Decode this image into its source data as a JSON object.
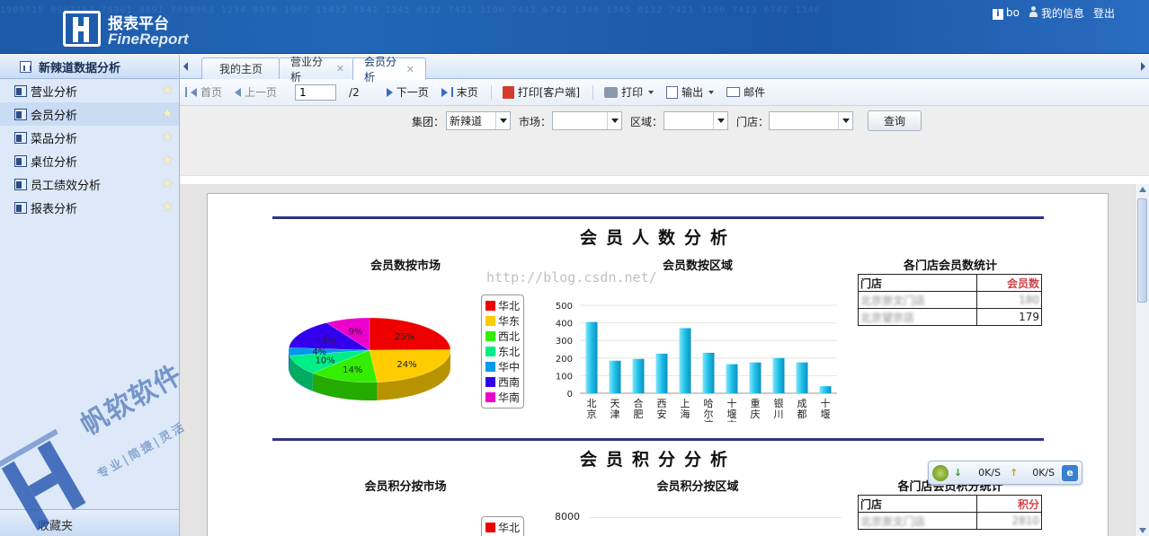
{
  "header": {
    "logo_title": "报表平台",
    "logo_sub": "FineReport",
    "username": "bo",
    "my_info": "我的信息",
    "logout": "登出",
    "bg_digits": "1989715 8987153 78961 9891 7698963 1234 8976 1987 15432 7842 1345 0132 7421 3190 7413 6742 1346 1345 0132 7421 3190 7413 6742 1346"
  },
  "sidebar": {
    "title": "新辣道数据分析",
    "items": [
      {
        "label": "营业分析"
      },
      {
        "label": "会员分析"
      },
      {
        "label": "菜品分析"
      },
      {
        "label": "桌位分析"
      },
      {
        "label": "员工绩效分析"
      },
      {
        "label": "报表分析"
      }
    ],
    "footer": "收藏夹"
  },
  "watermark": {
    "brand": "帆软软件",
    "slogan": "专业|简捷|灵活"
  },
  "tabs": [
    {
      "label": "我的主页"
    },
    {
      "label": "营业分析"
    },
    {
      "label": "会员分析"
    }
  ],
  "toolbar": {
    "first": "首页",
    "prev": "上一页",
    "page_value": "1",
    "page_total": "/2",
    "next": "下一页",
    "last": "末页",
    "print_client": "打印[客户端]",
    "print": "打印",
    "export": "输出",
    "mail": "邮件"
  },
  "params": {
    "group_label": "集团：",
    "group_value": "新辣道",
    "market_label": "市场：",
    "market_value": "",
    "region_label": "区域：",
    "region_value": "",
    "store_label": "门店：",
    "store_value": "",
    "query": "查询"
  },
  "report": {
    "sec1_title": "会员人数分析",
    "sec2_title": "会员积分分析",
    "watermark_url": "http://blog.csdn.net/",
    "table1": {
      "title": "各门店会员数统计",
      "col_store": "门店",
      "col_value": "会员数",
      "rows": [
        {
          "store": "北京崇文门店",
          "value": "180"
        },
        {
          "store": "北京望京店",
          "value": "179"
        }
      ]
    },
    "table2": {
      "title": "各门店会员积分统计",
      "col_store": "门店",
      "col_value": "积分",
      "rows": [
        {
          "store": "北京崇文门店",
          "value": "2810"
        }
      ]
    },
    "netmon": {
      "down": "0K/S",
      "up": "0K/S"
    }
  },
  "chart_data": [
    {
      "type": "pie",
      "title": "会员数按市场",
      "categories": [
        "华北",
        "华东",
        "西北",
        "东北",
        "华中",
        "西南",
        "华南"
      ],
      "values": [
        25,
        24,
        14,
        10,
        4,
        15,
        9
      ],
      "colors": [
        "#ee0000",
        "#ffcc00",
        "#33ee00",
        "#00ee88",
        "#0099ee",
        "#3300ee",
        "#ee00cc"
      ],
      "legend": "right"
    },
    {
      "type": "bar",
      "title": "会员数按区域",
      "categories": [
        "北京",
        "天津",
        "合肥",
        "西安",
        "上海",
        "哈尔滨",
        "十堰市",
        "重庆",
        "银川",
        "成都",
        "十堰"
      ],
      "values": [
        405,
        185,
        195,
        225,
        370,
        230,
        165,
        175,
        200,
        175,
        40
      ],
      "ylim": [
        0,
        500
      ],
      "yticks": [
        "500",
        "400",
        "300",
        "200",
        "100",
        "0"
      ],
      "color": "#1ec0e8"
    },
    {
      "type": "pie",
      "title": "会员积分按市场",
      "categories": [
        "华北"
      ],
      "colors": [
        "#ee0000"
      ],
      "legend": "right"
    },
    {
      "type": "bar",
      "title": "会员积分按区域",
      "yticks": [
        "8000"
      ]
    }
  ]
}
